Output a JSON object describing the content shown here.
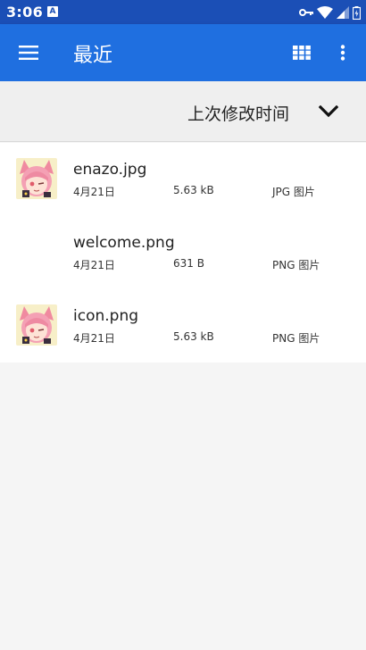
{
  "status_bar": {
    "time": "3:06",
    "notification_badge": "A"
  },
  "app_bar": {
    "title": "最近",
    "menu_icon": "hamburger-menu-icon",
    "grid_icon": "grid-view-icon",
    "more_icon": "more-vert-icon"
  },
  "sort": {
    "label": "上次修改时间",
    "toggle_icon": "chevron-down-icon"
  },
  "files": [
    {
      "name": "enazo.jpg",
      "date": "4月21日",
      "size": "5.63 kB",
      "type": "JPG 图片",
      "thumbnail": "anime-girl-thumbnail"
    },
    {
      "name": "welcome.png",
      "date": "4月21日",
      "size": "631 B",
      "type": "PNG 图片",
      "thumbnail": ""
    },
    {
      "name": "icon.png",
      "date": "4月21日",
      "size": "5.63 kB",
      "type": "PNG 图片",
      "thumbnail": "anime-girl-thumbnail"
    }
  ],
  "colors": {
    "status_bar": "#1b4fb6",
    "app_bar": "#1f6fe0",
    "background": "#f5f5f5",
    "list_background": "#ffffff"
  }
}
